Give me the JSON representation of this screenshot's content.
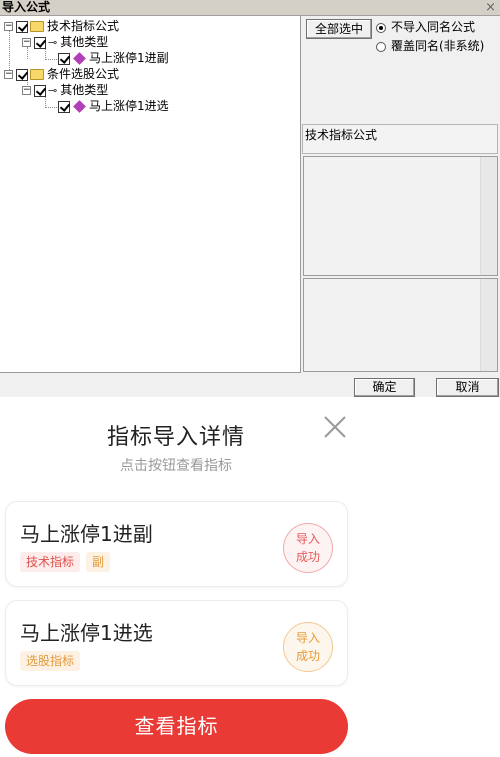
{
  "dialog": {
    "title": "导入公式",
    "tree": [
      {
        "label": "技术指标公式",
        "icon": "folder-icon"
      },
      {
        "label": "其他类型",
        "icon": "key-icon"
      },
      {
        "label": "马上涨停1进副",
        "icon": "formula-gem-icon"
      },
      {
        "label": "条件选股公式",
        "icon": "folder-icon"
      },
      {
        "label": "其他类型",
        "icon": "key-icon"
      },
      {
        "label": "马上涨停1进选",
        "icon": "formula-gem-icon"
      }
    ],
    "select_all_label": "全部选中",
    "radio_options": [
      {
        "label": "不导入同名公式",
        "selected": true
      },
      {
        "label": "覆盖同名(非系统)",
        "selected": false
      }
    ],
    "formula_type_label": "技术指标公式",
    "ok_label": "确定",
    "cancel_label": "取消"
  },
  "sheet": {
    "title": "指标导入详情",
    "subtitle": "点击按钮查看指标",
    "cards": [
      {
        "title": "马上涨停1进副",
        "tags": [
          "技术指标",
          "副"
        ],
        "stamp_line1": "导入",
        "stamp_line2": "成功"
      },
      {
        "title": "马上涨停1进选",
        "tags": [
          "选股指标"
        ],
        "stamp_line1": "导入",
        "stamp_line2": "成功"
      }
    ],
    "view_button_label": "查看指标"
  },
  "colors": {
    "accent_red": "#ea3a36",
    "tag_red": "#e0504a",
    "tag_orange": "#e39a3c"
  }
}
